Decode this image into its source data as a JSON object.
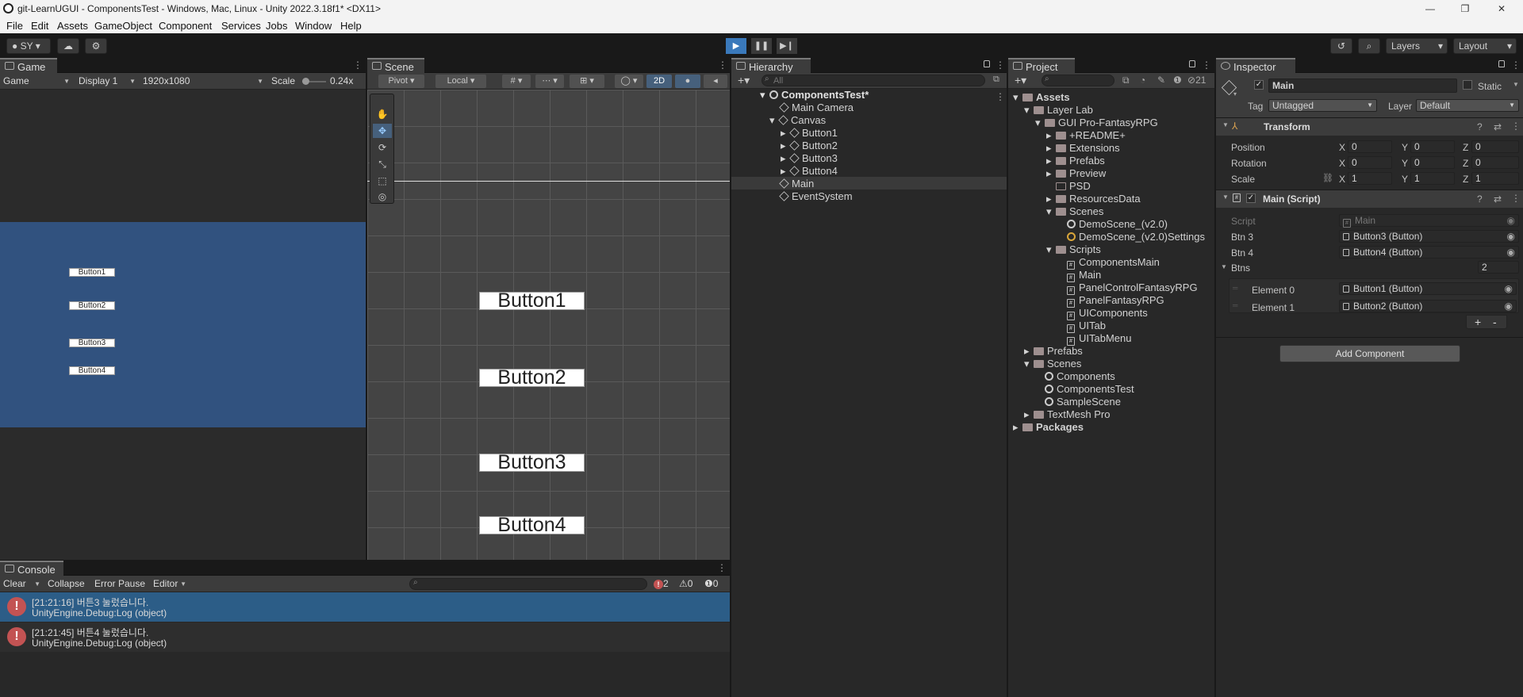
{
  "window": {
    "title": "git-LearnUGUI - ComponentsTest - Windows, Mac, Linux - Unity 2022.3.18f1* <DX11>",
    "min": "—",
    "max": "❐",
    "close": "✕"
  },
  "menu": [
    "File",
    "Edit",
    "Assets",
    "GameObject",
    "Component",
    "Services",
    "Jobs",
    "Window",
    "Help"
  ],
  "toolbar": {
    "account": "SY",
    "layers": "Layers",
    "layout": "Layout"
  },
  "game": {
    "tab": "Game",
    "mode": "Game",
    "display": "Display 1",
    "resolution": "1920x1080",
    "scale_label": "Scale",
    "scale_value": "0.24x",
    "buttons": [
      "Button1",
      "Button2",
      "Button3",
      "Button4"
    ]
  },
  "scene": {
    "tab": "Scene",
    "pivot": "Pivot",
    "local": "Local",
    "mode_2d": "2D",
    "buttons": [
      "Button1",
      "Button2",
      "Button3",
      "Button4"
    ]
  },
  "hierarchy": {
    "tab": "Hierarchy",
    "search_placeholder": "All",
    "root": "ComponentsTest*",
    "items": [
      "Main Camera",
      "Canvas",
      "Button1",
      "Button2",
      "Button3",
      "Button4",
      "Main",
      "EventSystem"
    ]
  },
  "project": {
    "tab": "Project",
    "badge": "21",
    "items": [
      "Assets",
      "Layer Lab",
      "GUI Pro-FantasyRPG",
      "+README+",
      "Extensions",
      "Prefabs",
      "Preview",
      "PSD",
      "ResourcesData",
      "Scenes",
      "DemoScene_(v2.0)",
      "DemoScene_(v2.0)Settings",
      "Scripts",
      "ComponentsMain",
      "Main",
      "PanelControlFantasyRPG",
      "PanelFantasyRPG",
      "UIComponents",
      "UITab",
      "UITabMenu",
      "Prefabs",
      "Scenes",
      "Components",
      "ComponentsTest",
      "SampleScene",
      "TextMesh Pro",
      "Packages"
    ]
  },
  "inspector": {
    "tab": "Inspector",
    "object_name": "Main",
    "static_label": "Static",
    "tag_label": "Tag",
    "tag_value": "Untagged",
    "layer_label": "Layer",
    "layer_value": "Default",
    "transform": {
      "title": "Transform",
      "position": {
        "label": "Position",
        "x": "0",
        "y": "0",
        "z": "0"
      },
      "rotation": {
        "label": "Rotation",
        "x": "0",
        "y": "0",
        "z": "0"
      },
      "scale": {
        "label": "Scale",
        "x": "1",
        "y": "1",
        "z": "1"
      }
    },
    "script": {
      "title": "Main (Script)",
      "script_label": "Script",
      "script_value": "Main",
      "btn3_label": "Btn 3",
      "btn3_value": "Button3 (Button)",
      "btn4_label": "Btn 4",
      "btn4_value": "Button4 (Button)",
      "btns_label": "Btns",
      "btns_count": "2",
      "element0_label": "Element 0",
      "element0_value": "Button1 (Button)",
      "element1_label": "Element 1",
      "element1_value": "Button2 (Button)",
      "plus": "+",
      "minus": "-"
    },
    "add_component": "Add Component"
  },
  "console": {
    "tab": "Console",
    "clear": "Clear",
    "collapse": "Collapse",
    "error_pause": "Error Pause",
    "editor": "Editor",
    "count_log": "2",
    "count_warn": "0",
    "count_err": "0",
    "entries": [
      {
        "line1": "[21:21:16] 버튼3 눌렀습니다.",
        "line2": "UnityEngine.Debug:Log (object)"
      },
      {
        "line1": "[21:21:45] 버튼4 눌렀습니다.",
        "line2": "UnityEngine.Debug:Log (object)"
      }
    ]
  },
  "colors": {
    "accent": "#3a79bb",
    "game_bg": "#31527f",
    "selection": "#2c5d87"
  }
}
